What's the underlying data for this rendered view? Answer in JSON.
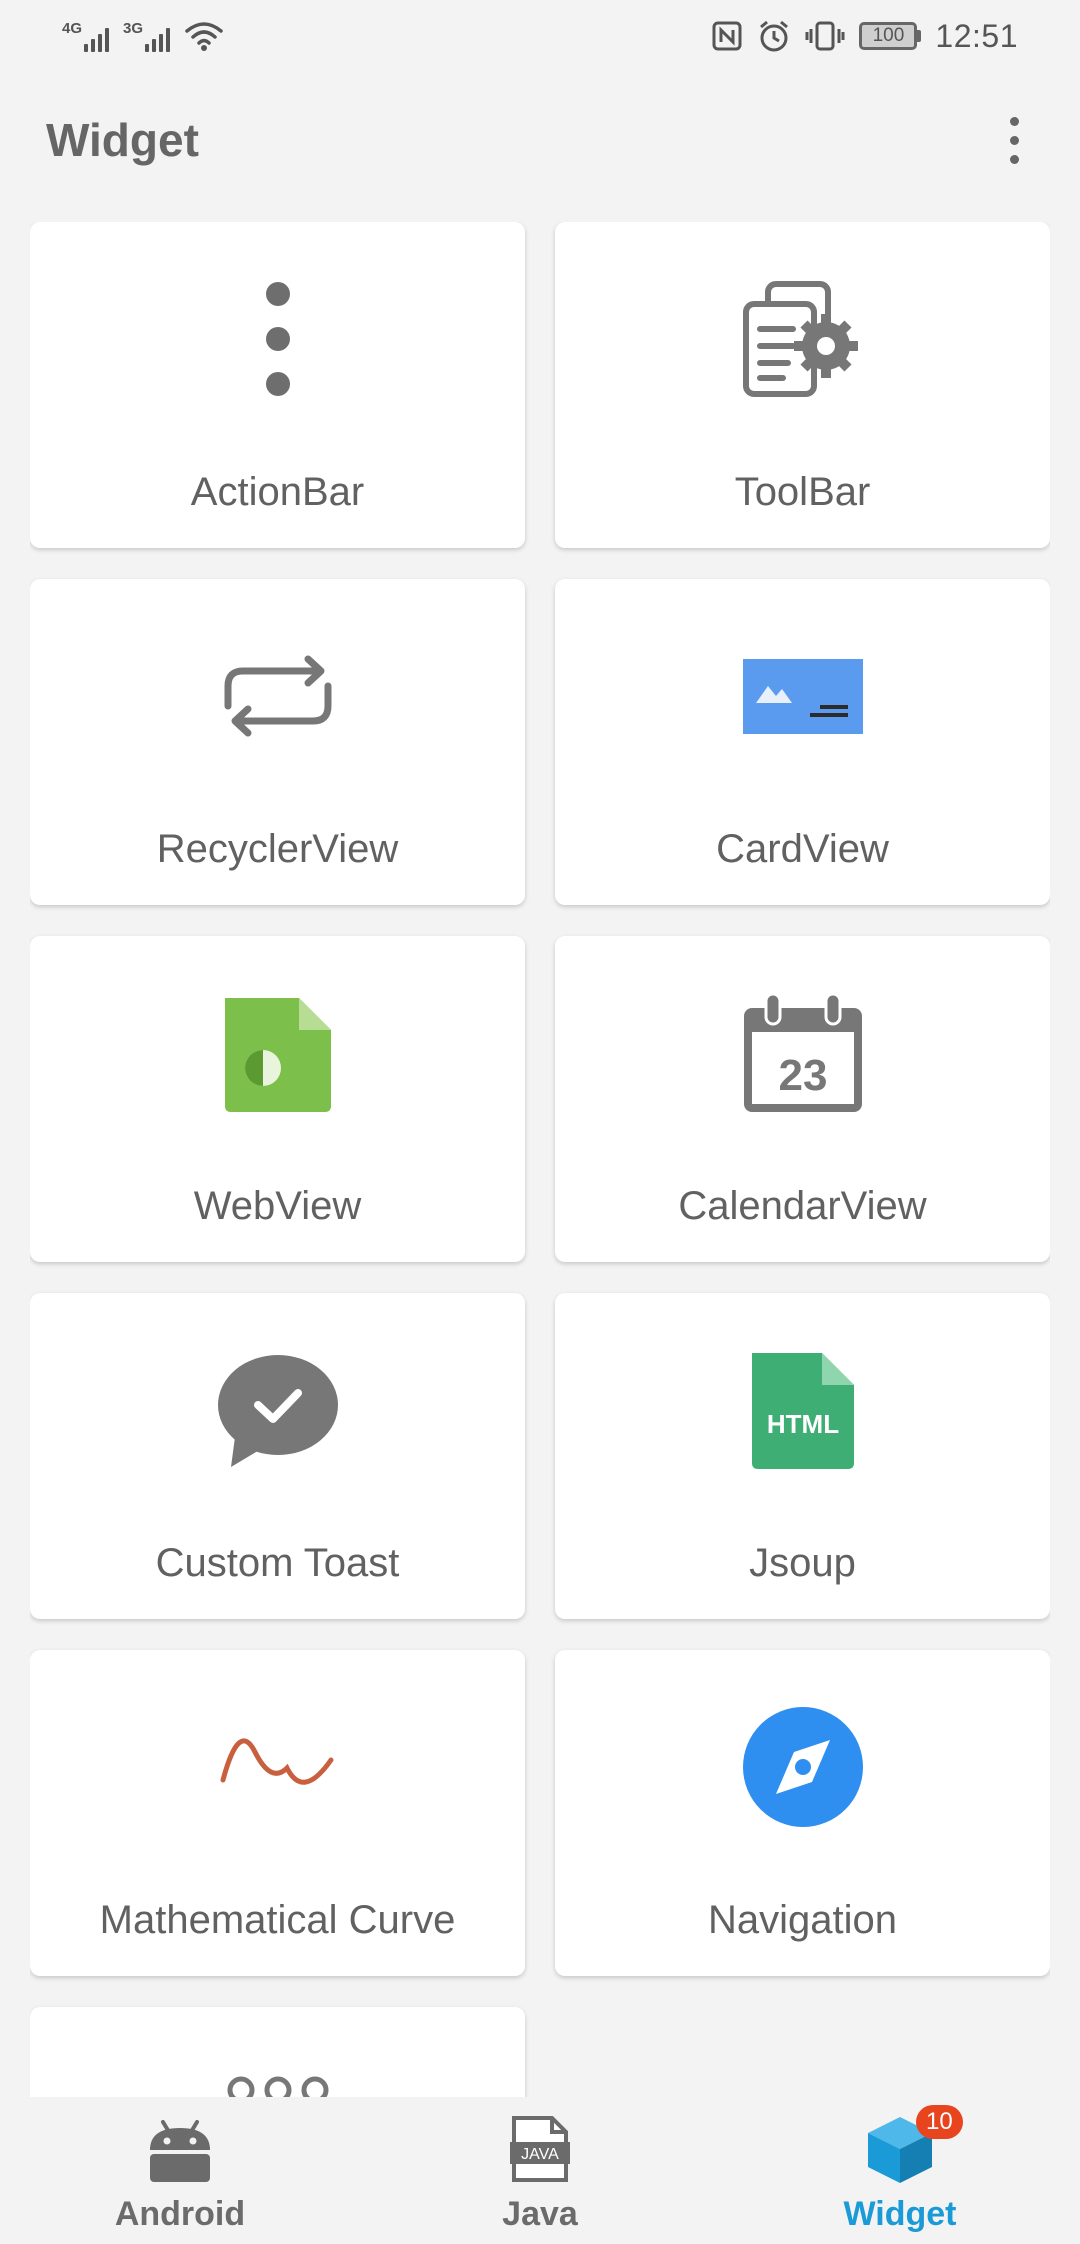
{
  "status_bar": {
    "net1": "4G",
    "net2": "3G",
    "battery": "100",
    "time": "12:51"
  },
  "app_bar": {
    "title": "Widget"
  },
  "cards": [
    {
      "label": "ActionBar",
      "icon": "more-vertical-icon"
    },
    {
      "label": "ToolBar",
      "icon": "document-settings-icon"
    },
    {
      "label": "RecyclerView",
      "icon": "repeat-icon"
    },
    {
      "label": "CardView",
      "icon": "image-card-icon"
    },
    {
      "label": "WebView",
      "icon": "green-document-icon"
    },
    {
      "label": "CalendarView",
      "icon": "calendar-icon",
      "icon_text": "23"
    },
    {
      "label": "Custom Toast",
      "icon": "chat-check-icon"
    },
    {
      "label": "Jsoup",
      "icon": "html-file-icon",
      "icon_text": "HTML"
    },
    {
      "label": "Mathematical Curve",
      "icon": "sine-wave-icon"
    },
    {
      "label": "Navigation",
      "icon": "compass-icon"
    },
    {
      "label": "",
      "icon": "three-circles-icon"
    }
  ],
  "bottom_nav": {
    "items": [
      {
        "label": "Android",
        "icon": "android-icon",
        "active": false
      },
      {
        "label": "Java",
        "icon": "java-file-icon",
        "icon_text": "JAVA",
        "active": false
      },
      {
        "label": "Widget",
        "icon": "cube-icon",
        "active": true,
        "badge": "10"
      }
    ]
  },
  "colors": {
    "background": "#f3f3f3",
    "card": "#ffffff",
    "text": "#616161",
    "accent": "#1a9ad6",
    "badge": "#e8451f",
    "webview_green": "#7cc04b",
    "jsoup_green": "#3fae74",
    "cardview_blue": "#5b9bef",
    "navigation_blue": "#2f8ff0",
    "curve_red": "#c8603f"
  }
}
